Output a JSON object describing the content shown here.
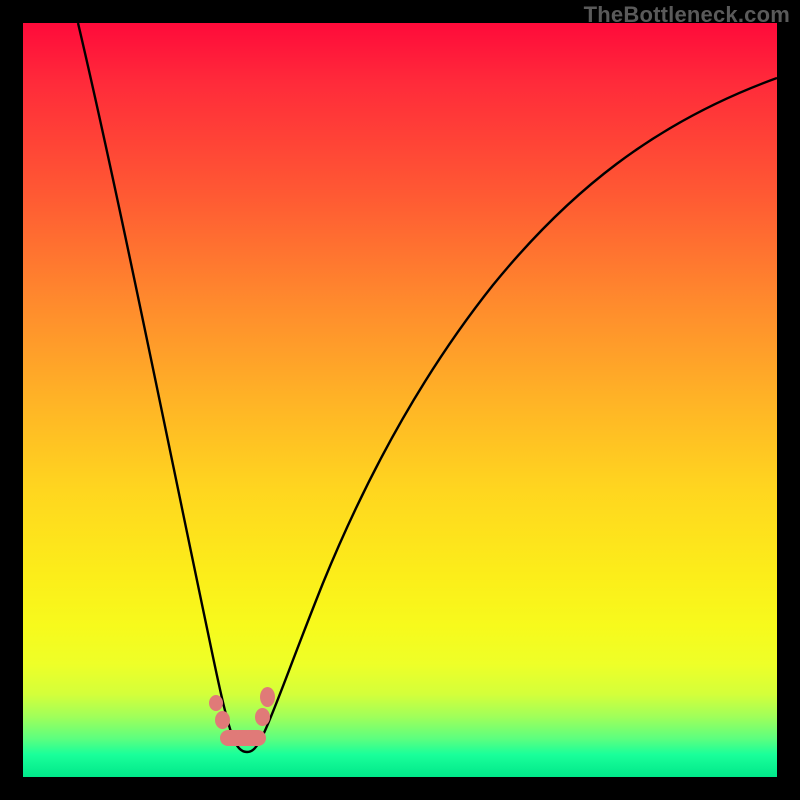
{
  "watermark": "TheBottleneck.com",
  "colors": {
    "gradient_top": "#ff0a3a",
    "gradient_bottom": "#00e88a",
    "curve": "#000000",
    "marker": "#e07a78",
    "frame_bg": "#000000"
  },
  "chart_data": {
    "type": "line",
    "title": "",
    "xlabel": "",
    "ylabel": "",
    "xlim": [
      0,
      100
    ],
    "ylim": [
      0,
      100
    ],
    "x": [
      0,
      5,
      10,
      15,
      20,
      24,
      26,
      28,
      30,
      32,
      35,
      40,
      45,
      50,
      55,
      60,
      65,
      70,
      75,
      80,
      85,
      90,
      95,
      100
    ],
    "values": [
      100,
      82,
      64,
      46,
      28,
      8,
      2,
      0,
      0,
      4,
      15,
      30,
      42,
      52,
      60,
      67,
      73,
      78,
      82,
      85,
      88,
      90,
      92,
      93
    ],
    "series": [
      {
        "name": "bottleneck-curve",
        "x": [
          0,
          5,
          10,
          15,
          20,
          24,
          26,
          28,
          30,
          32,
          35,
          40,
          45,
          50,
          55,
          60,
          65,
          70,
          75,
          80,
          85,
          90,
          95,
          100
        ],
        "y": [
          100,
          82,
          64,
          46,
          28,
          8,
          2,
          0,
          0,
          4,
          15,
          30,
          42,
          52,
          60,
          67,
          73,
          78,
          82,
          85,
          88,
          90,
          92,
          93
        ]
      }
    ],
    "markers": [
      {
        "name": "left-dot-top",
        "x": 25.5,
        "y": 6
      },
      {
        "name": "left-dot-bot",
        "x": 26.5,
        "y": 3
      },
      {
        "name": "right-dot-top",
        "x": 32.5,
        "y": 7
      },
      {
        "name": "right-dot-bot",
        "x": 32.0,
        "y": 4
      },
      {
        "name": "underline-start",
        "x": 27.0,
        "y": 1
      },
      {
        "name": "underline-end",
        "x": 31.5,
        "y": 1
      }
    ],
    "annotations": []
  }
}
